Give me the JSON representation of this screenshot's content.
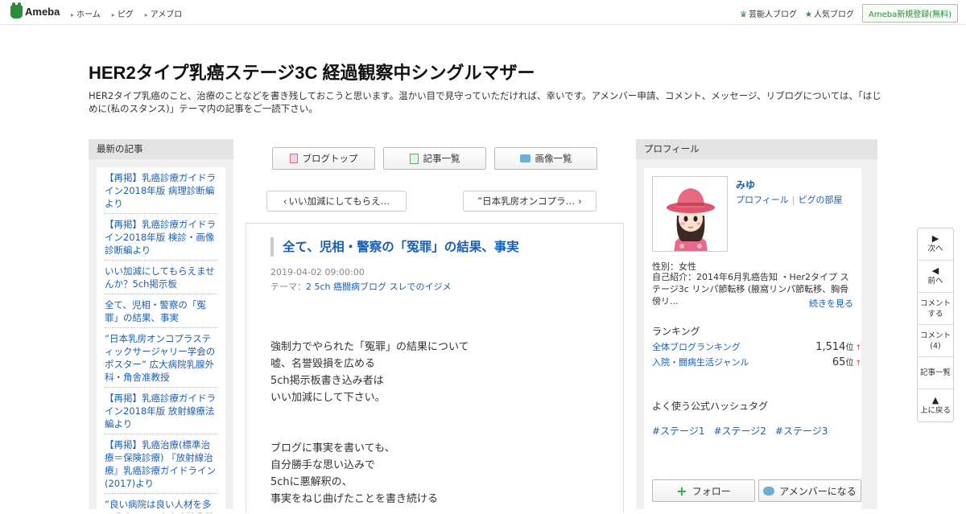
{
  "topbar": {
    "logo": "Ameba",
    "nav": [
      "ホーム",
      "ピグ",
      "アメブロ"
    ],
    "celeb_blog": "芸能人ブログ",
    "popular_blog": "人気ブログ",
    "register": "Ameba新規登録(無料)"
  },
  "header": {
    "title": "HER2タイプ乳癌ステージ3C 経過観察中シングルマザー",
    "description": "HER2タイプ乳癌のこと、治療のことなどを書き残しておこうと思います。温かい目で見守っていただければ、幸いです。アメンバー申請、コメント、メッセージ、リブログについては、「はじめに(私のスタンス)」テーマ内の記事をご一読下さい。"
  },
  "left": {
    "heading": "最新の記事",
    "items": [
      "【再掲】乳癌診療ガイドライン2018年版 病理診断編より",
      "【再掲】乳癌診療ガイドライン2018年版 検診・画像診断編より",
      "いい加減にしてもらえませんか？5ch掲示板",
      "全て、児相・警察の「冤罪」の結果、事実",
      "”日本乳房オンコプラスティックサージャリー学会のポスター” 広大病院乳腺外科・角舎准教授",
      "【再掲】乳癌診療ガイドライン2018年版 放射線療法編より",
      "【再掲】乳癌治療(標準治療＝保険診療) 『放射線治療』乳癌診療ガイドライン(2017)より",
      "”良い病院は良い人材を多く輩出する” 広大病院乳腺"
    ]
  },
  "center": {
    "buttons": {
      "top": "ブログトップ",
      "list": "記事一覧",
      "images": "画像一覧"
    },
    "prev": "いい加減にしてもらえ…",
    "next": "”日本乳房オンコプラ…",
    "entry": {
      "title": "全て、児相・警察の「冤罪」の結果、事実",
      "date": "2019-04-02 09:00:00",
      "theme_label": "テーマ：",
      "theme": "2 5ch 癌闘病ブログ スレでのイジメ",
      "para1": [
        "強制力でやられた「冤罪」の結果について",
        "嘘、名誉毀損を広める",
        "5ch掲示板書き込み者は",
        "いい加減にして下さい。"
      ],
      "para2": [
        "ブログに事実を書いても、",
        "自分勝手な思い込みで",
        "5chに悪解釈の、",
        "事実をねじ曲げたことを書き続ける"
      ]
    }
  },
  "right": {
    "heading": "プロフィール",
    "name": "みゆ",
    "profile_link": "プロフィール",
    "pig_link": "ピグの部屋",
    "gender": "性別：女性",
    "intro": "自己紹介：2014年6月乳癌告知 ・Her2タイプ ステージ3c リンパ節転移 (腋窩リンパ節転移、胸骨傍リ...",
    "more": "続きを見る",
    "ranking_head": "ランキング",
    "rankings": [
      {
        "label": "全体ブログランキング",
        "value": "1,514",
        "unit": "位",
        "arrow": "↑"
      },
      {
        "label": "入院・闘病生活ジャンル",
        "value": "65",
        "unit": "位",
        "arrow": "↑"
      }
    ],
    "hashtag_head": "よく使う公式ハッシュタグ",
    "hashtags": [
      "#ステージ1",
      "#ステージ2",
      "#ステージ3"
    ],
    "follow": "フォロー",
    "member": "アメンバーになる"
  },
  "floatnav": {
    "next": "次へ",
    "prev": "前へ",
    "comment_line1": "コメント",
    "comment_line2": "する",
    "comments_line1": "コメント",
    "comments_line2": "(4)",
    "list": "記事一覧",
    "top": "上に戻る"
  }
}
